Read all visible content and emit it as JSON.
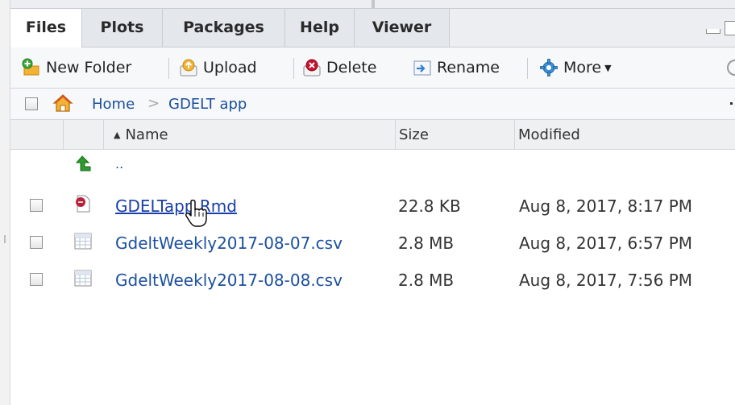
{
  "tabs": [
    {
      "label": "Files",
      "active": true
    },
    {
      "label": "Plots",
      "active": false
    },
    {
      "label": "Packages",
      "active": false
    },
    {
      "label": "Help",
      "active": false
    },
    {
      "label": "Viewer",
      "active": false
    }
  ],
  "toolbar": {
    "new_folder_label": "New Folder",
    "upload_label": "Upload",
    "delete_label": "Delete",
    "rename_label": "Rename",
    "more_label": "More"
  },
  "breadcrumb": {
    "home_label": "Home",
    "separator": ">",
    "current": "GDELT app"
  },
  "columns": {
    "name": "Name",
    "size": "Size",
    "modified": "Modified"
  },
  "parent_dir_label": "..",
  "files": [
    {
      "name": "GDELTapp.Rmd",
      "size": "22.8 KB",
      "modified": "Aug 8, 2017, 8:17 PM",
      "type": "rmd"
    },
    {
      "name": "GdeltWeekly2017-08-07.csv",
      "size": "2.8 MB",
      "modified": "Aug 8, 2017, 6:57 PM",
      "type": "csv"
    },
    {
      "name": "GdeltWeekly2017-08-08.csv",
      "size": "2.8 MB",
      "modified": "Aug 8, 2017, 7:56 PM",
      "type": "csv"
    }
  ],
  "colors": {
    "link": "#1b4f9e",
    "folder_yellow": "#f2b233",
    "delete_red": "#c8102e",
    "up_arrow_green": "#2e9b2e"
  },
  "icons": {
    "new_folder": "new-folder-icon",
    "upload": "upload-icon",
    "delete": "delete-icon",
    "rename": "rename-icon",
    "more": "gear-icon",
    "home": "home-icon",
    "parent": "up-arrow-icon",
    "rmd": "rmd-file-icon",
    "csv": "csv-file-icon"
  }
}
